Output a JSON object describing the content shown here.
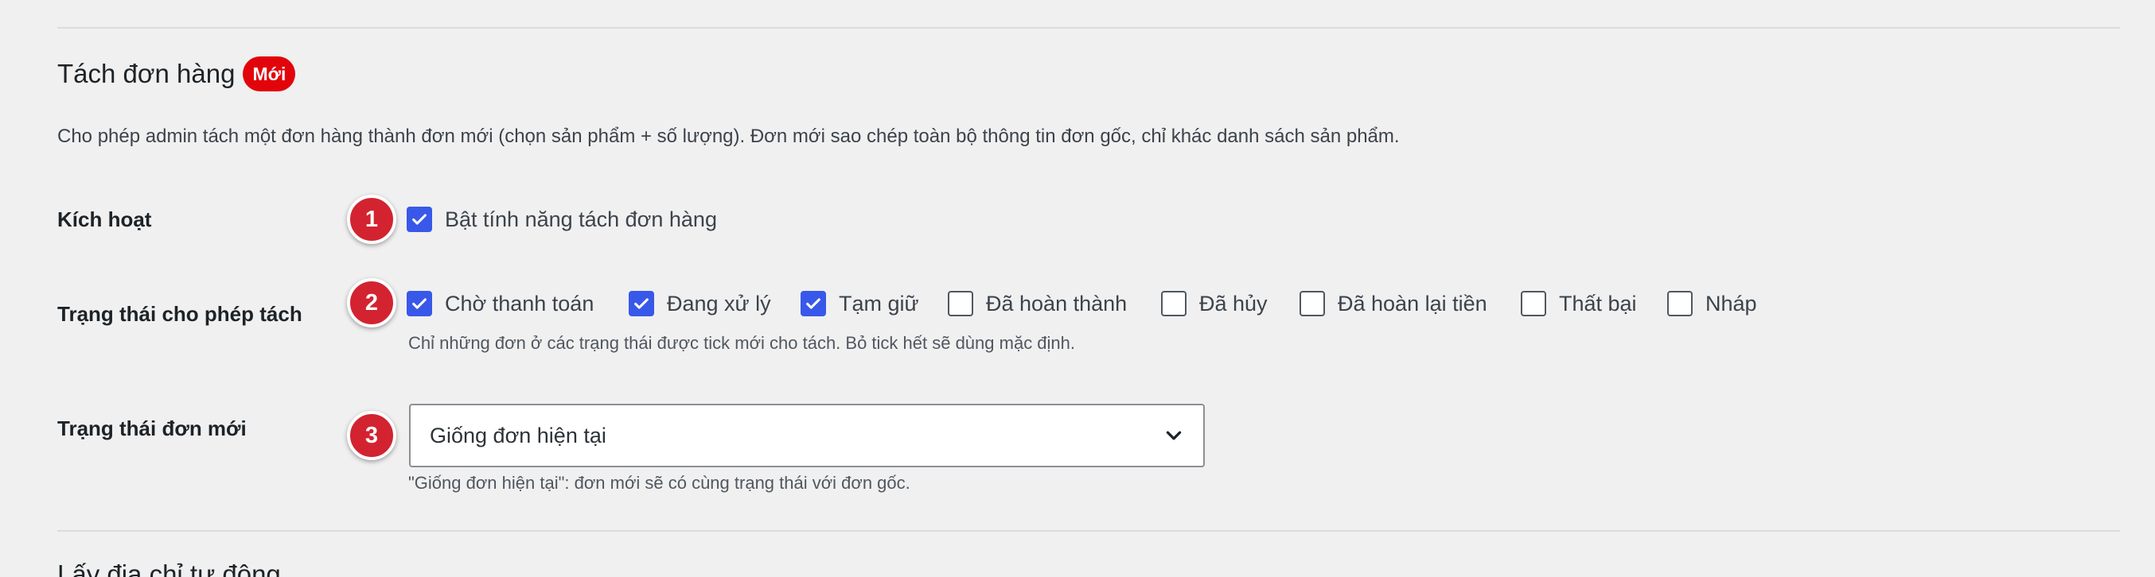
{
  "section": {
    "title": "Tách đơn hàng",
    "badge": "Mới",
    "description": "Cho phép admin tách một đơn hàng thành đơn mới (chọn sản phẩm + số lượng). Đơn mới sao chép toàn bộ thông tin đơn gốc, chỉ khác danh sách sản phẩm."
  },
  "steps": [
    "1",
    "2",
    "3"
  ],
  "activate": {
    "label": "Kích hoạt",
    "checkbox_label": "Bật tính năng tách đơn hàng",
    "checked": true
  },
  "statuses": {
    "label": "Trạng thái cho phép tách",
    "options": [
      {
        "label": "Chờ thanh toán",
        "checked": true
      },
      {
        "label": "Đang xử lý",
        "checked": true
      },
      {
        "label": "Tạm giữ",
        "checked": true
      },
      {
        "label": "Đã hoàn thành",
        "checked": false
      },
      {
        "label": "Đã hủy",
        "checked": false
      },
      {
        "label": "Đã hoàn lại tiền",
        "checked": false
      },
      {
        "label": "Thất bại",
        "checked": false
      },
      {
        "label": "Nháp",
        "checked": false
      }
    ],
    "hint": "Chỉ những đơn ở các trạng thái được tick mới cho tách. Bỏ tick hết sẽ dùng mặc định."
  },
  "new_status": {
    "label": "Trạng thái đơn mới",
    "selected": "Giống đơn hiện tại",
    "hint": "\"Giống đơn hiện tại\": đơn mới sẽ có cùng trạng thái với đơn gốc."
  },
  "next_section": {
    "title": "Lấy địa chỉ tự động"
  },
  "colors": {
    "accent": "#3858e9",
    "badge": "#e2040b",
    "step": "#d32330"
  },
  "icons": {
    "checkmark": "checkmark-icon",
    "dropdown": "chevron-down-icon"
  }
}
